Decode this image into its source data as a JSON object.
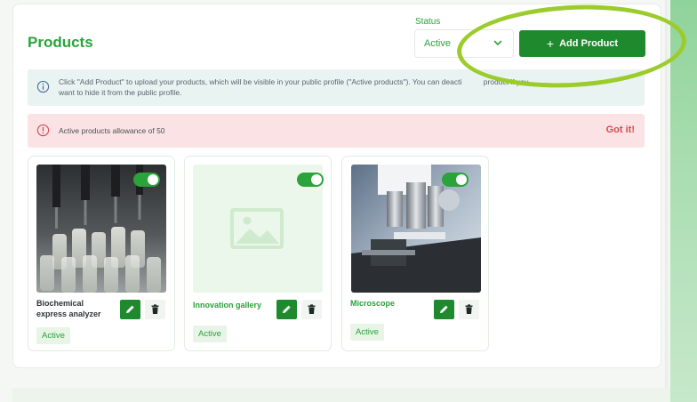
{
  "page": {
    "title": "Products"
  },
  "status_filter": {
    "label": "Status",
    "selected": "Active"
  },
  "add_button": {
    "label": "Add Product"
  },
  "info_banner": {
    "text": "Click \"Add Product\" to upload your products, which will be visible in your public profile (\"Active products\"). You can deacti",
    "text_after_highlight": "product if you",
    "text_line2": "want to hide it from the public profile."
  },
  "alert_banner": {
    "text": "Active products allowance of 50",
    "dismiss_label": "Got it!"
  },
  "products": [
    {
      "name": "Biochemical express analyzer",
      "status": "Active",
      "image": "analyzer-photo",
      "enabled": true
    },
    {
      "name": "Innovation gallery",
      "status": "Active",
      "image": "image-placeholder-icon",
      "enabled": true
    },
    {
      "name": "Microscope",
      "status": "Active",
      "image": "microscope-photo",
      "enabled": true
    }
  ],
  "colors": {
    "brand_green": "#2aa33b",
    "button_green": "#1f8a2d",
    "info_bg": "#e9f3f1",
    "alert_bg": "#fbe3e5",
    "alert_text": "#d64a54",
    "highlight": "#9ccc2c"
  }
}
